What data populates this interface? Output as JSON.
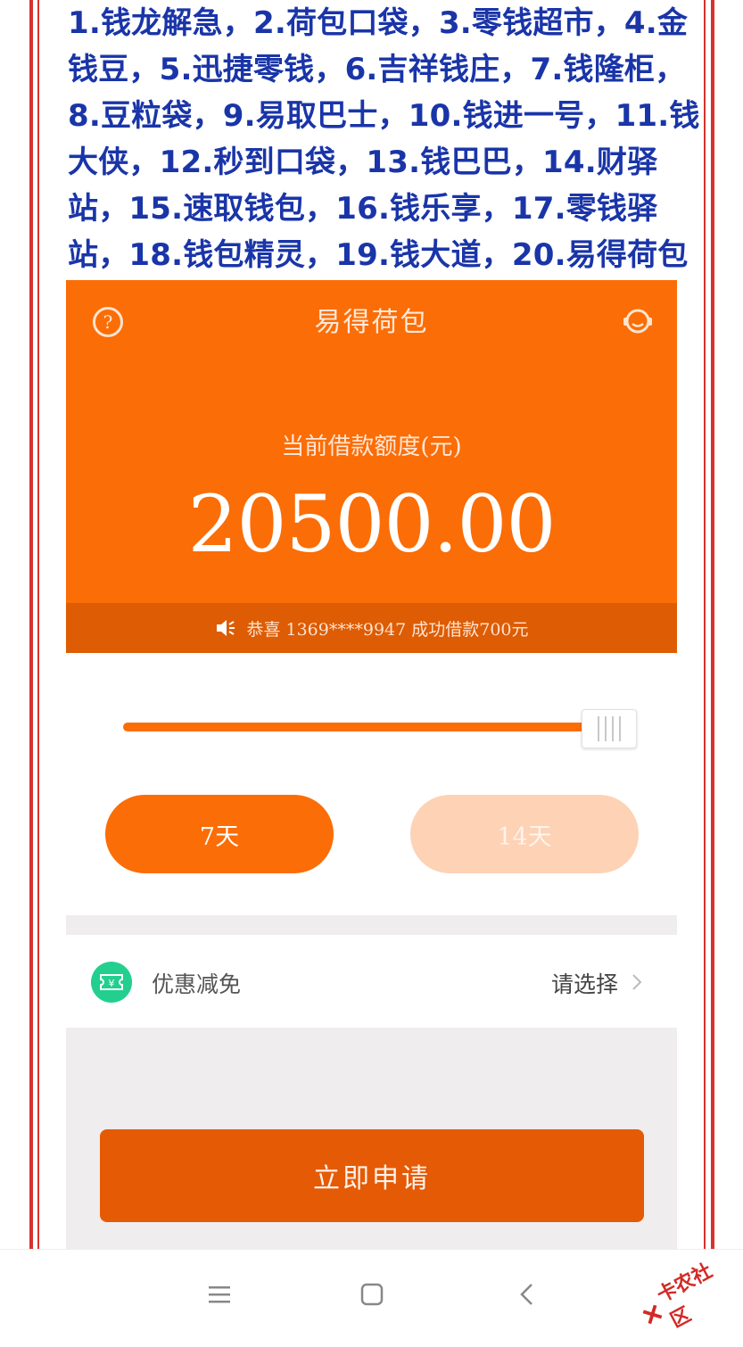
{
  "headline": {
    "lines": [
      "1.钱龙解急，2.荷包口袋，3.零钱超市，4.金",
      "钱豆，5.迅捷零钱，6.吉祥钱庄，7.钱隆柜，",
      "8.豆粒袋，9.易取巴士，10.钱进一号，11.钱",
      "大侠，12.秒到口袋，13.钱巴巴，14.财驿",
      "站，15.速取钱包，16.钱乐享，17.零钱驿",
      "站，18.钱包精灵，19.钱大道，20.易得荷包"
    ]
  },
  "app": {
    "title": "易得荷包",
    "quota_label": "当前借款额度(元)",
    "amount": "20500.00",
    "notice": "恭喜 1369****9947 成功借款700元",
    "slider_fraction": 1.0,
    "terms": [
      {
        "label": "7天",
        "selected": true
      },
      {
        "label": "14天",
        "selected": false
      }
    ],
    "discount": {
      "label": "优惠减免",
      "select": "请选择"
    },
    "apply_label": "立即申请"
  },
  "watermark": {
    "text": "卡农社区"
  },
  "colors": {
    "brand_orange": "#fb6d06",
    "headline_blue": "#1a35a8",
    "border_red": "#d8312e",
    "ticket_green": "#22cf8e"
  }
}
